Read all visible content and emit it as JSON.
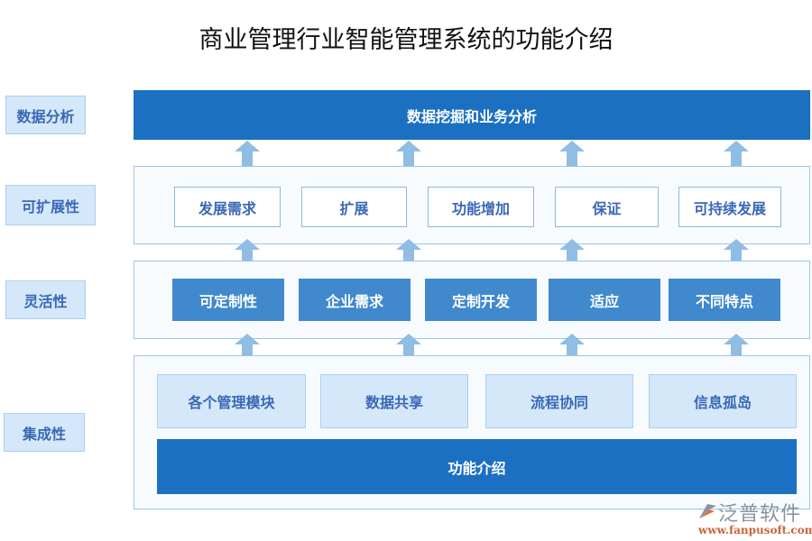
{
  "title": "商业管理行业智能管理系统的功能介绍",
  "side_labels": [
    "数据分析",
    "可扩展性",
    "灵活性",
    "集成性"
  ],
  "top_bar": "数据挖掘和业务分析",
  "scalability": [
    "发展需求",
    "扩展",
    "功能增加",
    "保证",
    "可持续发展"
  ],
  "flexibility": [
    "可定制性",
    "企业需求",
    "定制开发",
    "适应",
    "不同特点"
  ],
  "integration": [
    "各个管理模块",
    "数据共享",
    "流程协同",
    "信息孤岛"
  ],
  "bottom_bar": "功能介绍",
  "logo": {
    "name": "泛普软件",
    "url": "www.fanpusoft.com"
  },
  "colors": {
    "primary": "#1b70c2",
    "medium": "#4189cd",
    "light": "#d4e8fa",
    "arrow": "#8fbde3",
    "text_blue": "#3a68b6"
  }
}
